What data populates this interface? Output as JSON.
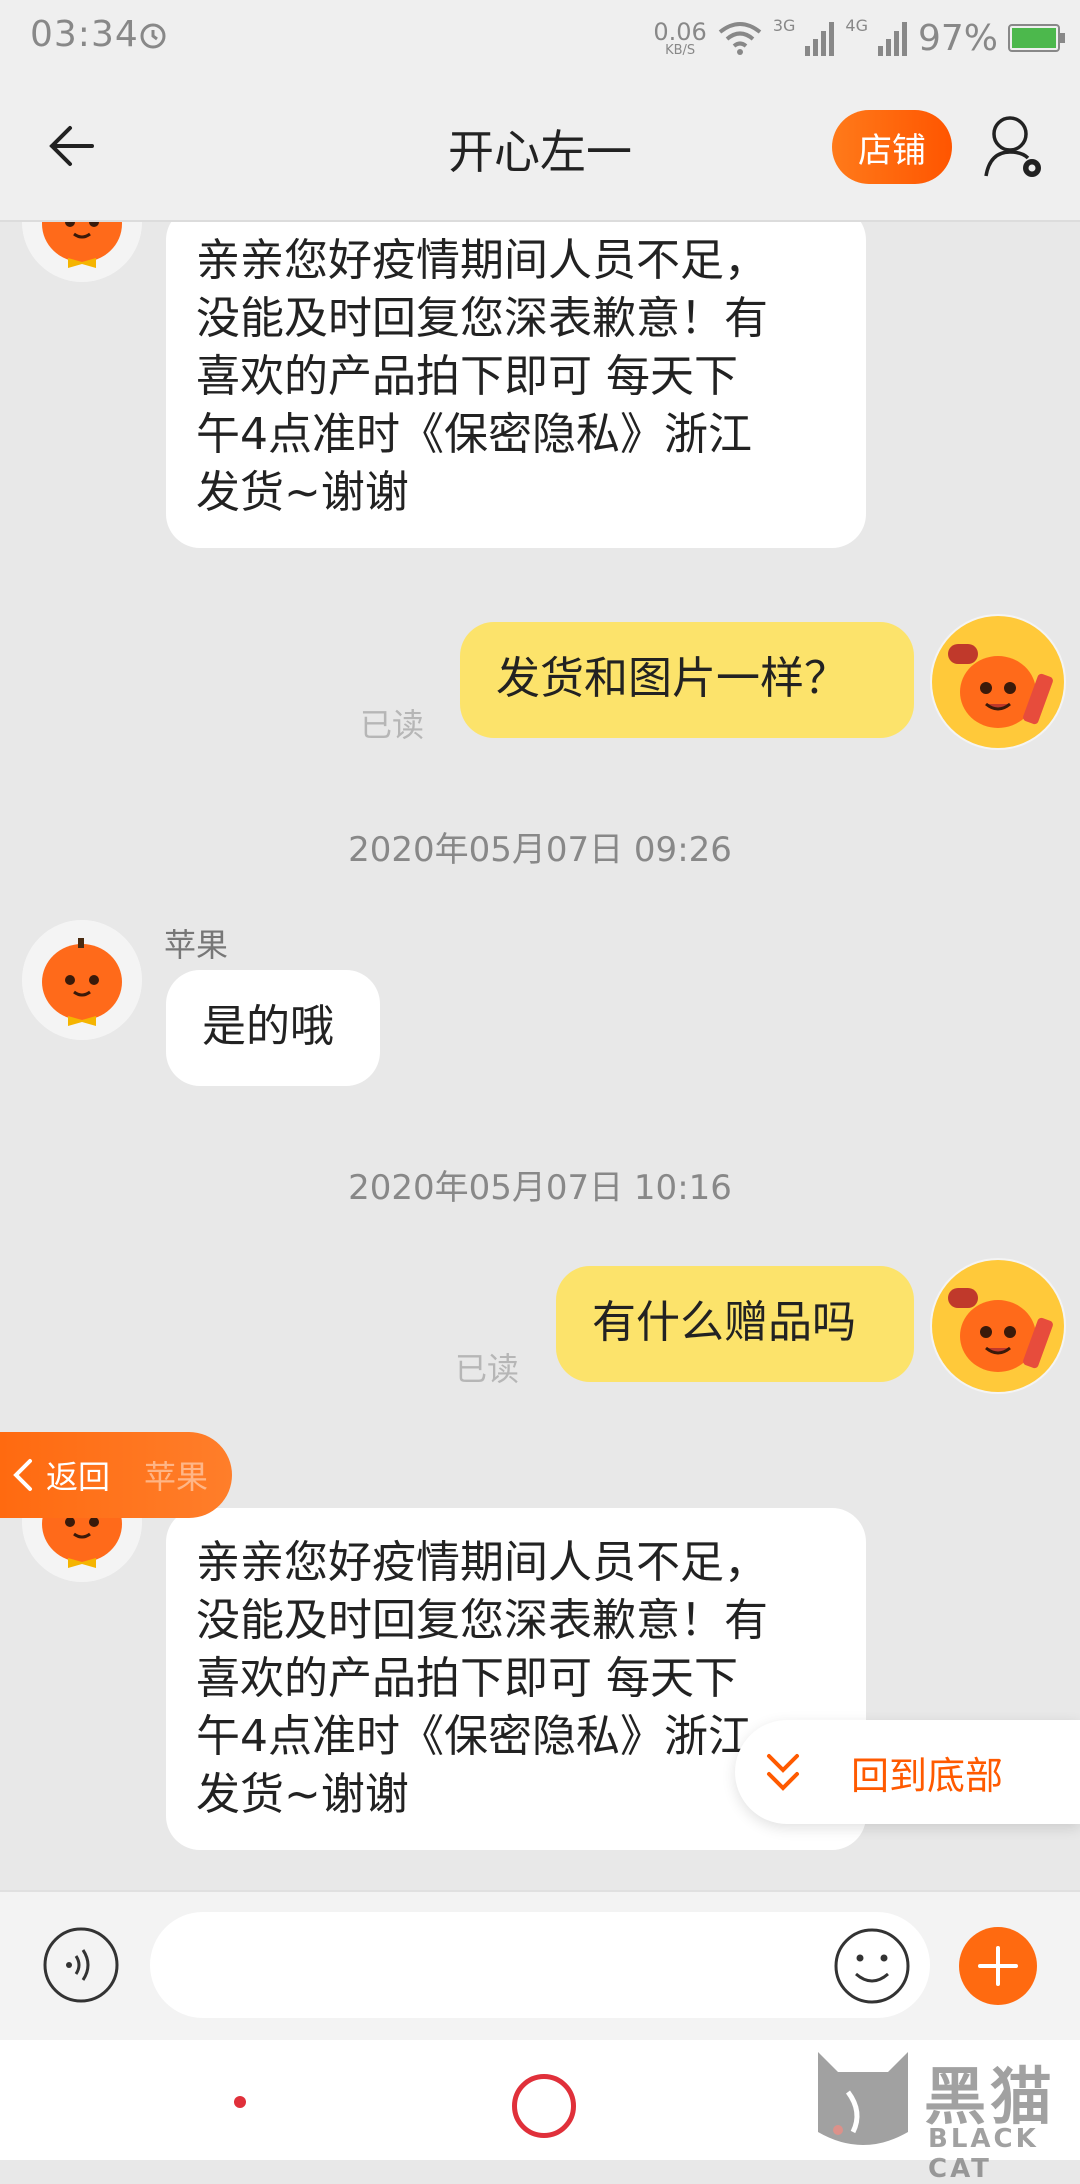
{
  "status_bar": {
    "time": "03:34",
    "net_speed_value": "0.06",
    "net_speed_unit": "KB/S",
    "signal_1": "3G",
    "signal_2": "4G",
    "battery": "97%",
    "icons": [
      "alarm-icon",
      "wifi-icon",
      "signal-icon",
      "battery-icon"
    ]
  },
  "header": {
    "title": "开心左一",
    "shop_label": "店铺",
    "icons": [
      "back-arrow-icon",
      "user-settings-icon"
    ]
  },
  "messages": [
    {
      "side": "left",
      "sender": "",
      "text_lines": [
        "亲亲您好疫情期间人员不足，",
        "没能及时回复您深表歉意！有",
        "喜欢的产品拍下即可 每天下",
        "午4点准时《保密隐私》浙江",
        "发货~谢谢"
      ]
    },
    {
      "side": "right",
      "text": "发货和图片一样？",
      "status": "已读"
    },
    {
      "time_separator": "2020年05月07日  09:26"
    },
    {
      "side": "left",
      "sender": "苹果",
      "text": "是的哦"
    },
    {
      "time_separator": "2020年05月07日  10:16"
    },
    {
      "side": "right",
      "text": "有什么赠品吗",
      "status": "已读"
    },
    {
      "side": "left",
      "sender": "苹果",
      "text_lines": [
        "亲亲您好疫情期间人员不足，",
        "没能及时回复您深表歉意！有",
        "喜欢的产品拍下即可 每天下",
        "午4点准时《保密隐私》浙江",
        "发货~谢谢"
      ]
    }
  ],
  "overlays": {
    "return_label": "返回",
    "to_bottom_label": "回到底部"
  },
  "input_bar": {
    "placeholder": "",
    "icons": [
      "voice-icon",
      "emoji-icon",
      "plus-icon"
    ]
  },
  "watermark": {
    "cn": "黑猫",
    "en": "BLACK CAT"
  },
  "colors": {
    "accent": "#ff5a00",
    "my_bubble": "#fce36b",
    "background": "#e8e8e8"
  }
}
